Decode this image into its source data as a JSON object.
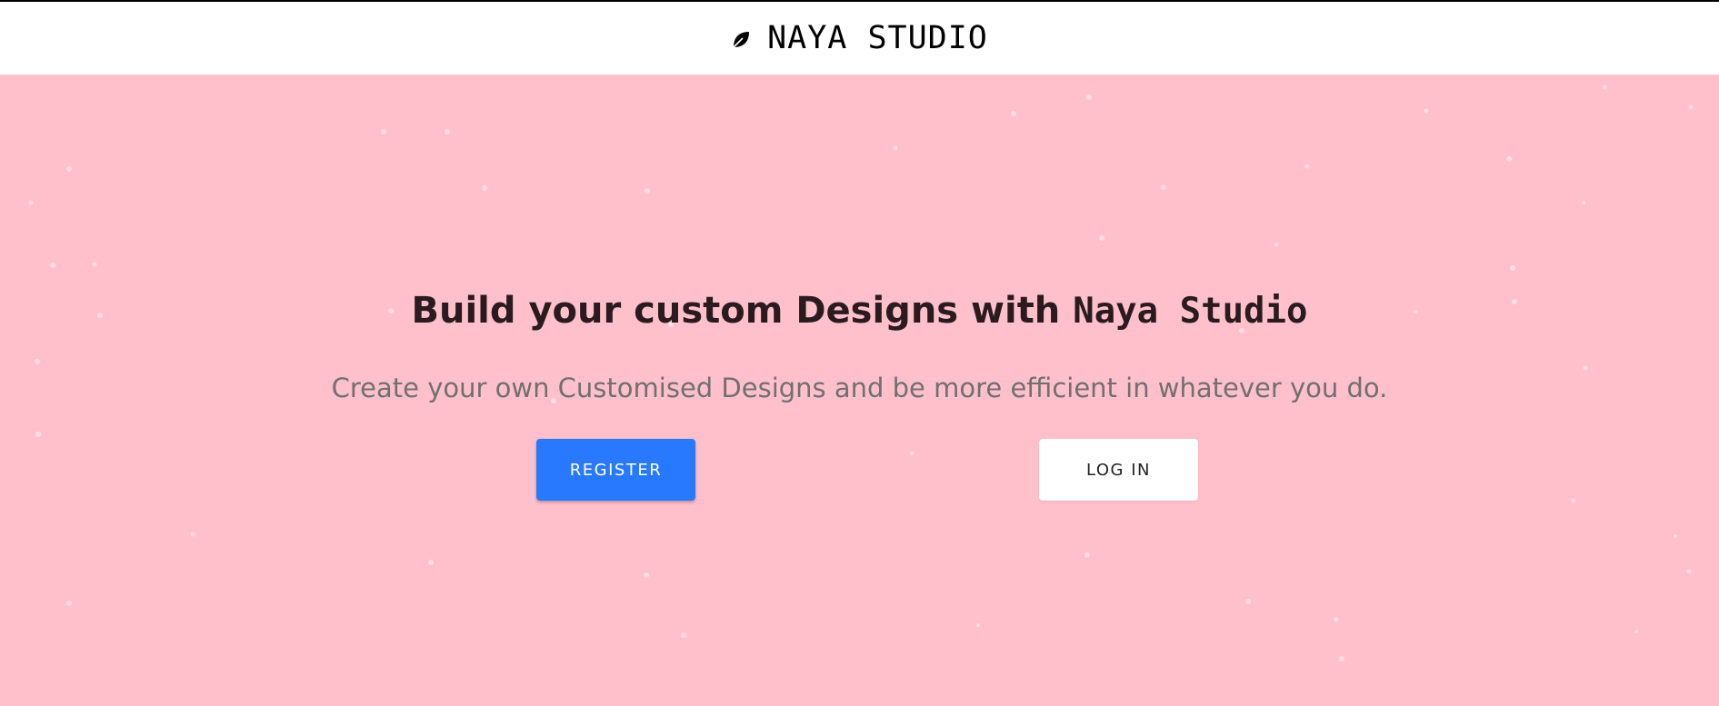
{
  "header": {
    "icon": "leaf-icon",
    "brand": "NAYA STUDIO"
  },
  "hero": {
    "background": "#ffc0cb",
    "headline": {
      "bold": "Build",
      "middle": " your custom Designs with ",
      "mono": "Naya Studio"
    },
    "subheadline": "Create your own Customised Designs and be more efficient in whatever you do.",
    "register_label": "REGISTER",
    "login_label": "LOG IN",
    "register_color": "#2979ff"
  }
}
